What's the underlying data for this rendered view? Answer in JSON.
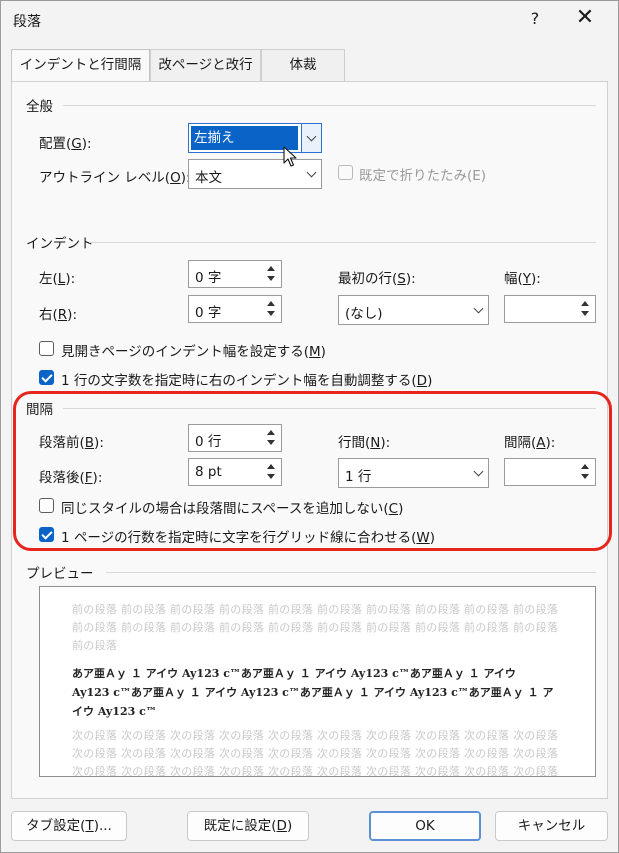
{
  "window": {
    "title": "段落",
    "help": "?",
    "close": "✕"
  },
  "tabs": [
    {
      "label": "インデントと行間隔",
      "active": true
    },
    {
      "label": "改ページと改行",
      "active": false
    },
    {
      "label": "体裁",
      "active": false
    }
  ],
  "general": {
    "title": "全般",
    "alignment_label": "配置(",
    "alignment_key": "G",
    "alignment_suffix": "):",
    "alignment_value": "左揃え",
    "outline_label": "アウトライン レベル(",
    "outline_key": "O",
    "outline_suffix": "):",
    "outline_value": "本文",
    "collapsed_label": "既定で折りたたみ(E)"
  },
  "indent": {
    "title": "インデント",
    "left_label": "左(",
    "left_key": "L",
    "left_suffix": "):",
    "left_value": "0 字",
    "right_label": "右(",
    "right_key": "R",
    "right_suffix": "):",
    "right_value": "0 字",
    "first_line_label": "最初の行(",
    "first_line_key": "S",
    "first_line_suffix": "):",
    "first_line_value": "(なし)",
    "width_label": "幅(",
    "width_key": "Y",
    "width_suffix": "):",
    "width_value": "",
    "mirror_label": "見開きページのインデント幅を設定する(",
    "mirror_key": "M",
    "mirror_suffix": ")",
    "mirror_checked": false,
    "auto_adjust_label": "1 行の文字数を指定時に右のインデント幅を自動調整する(",
    "auto_adjust_key": "D",
    "auto_adjust_suffix": ")",
    "auto_adjust_checked": true
  },
  "spacing": {
    "title": "間隔",
    "before_label": "段落前(",
    "before_key": "B",
    "before_suffix": "):",
    "before_value": "0 行",
    "after_label": "段落後(",
    "after_key": "F",
    "after_suffix": "):",
    "after_value": "8 pt",
    "line_spacing_label": "行間(",
    "line_spacing_key": "N",
    "line_spacing_suffix": "):",
    "line_spacing_value": "1 行",
    "at_label": "間隔(",
    "at_key": "A",
    "at_suffix": "):",
    "at_value": "",
    "no_space_label": "同じスタイルの場合は段落間にスペースを追加しない(",
    "no_space_key": "C",
    "no_space_suffix": ")",
    "no_space_checked": false,
    "grid_label": "1 ページの行数を指定時に文字を行グリッド線に合わせる(",
    "grid_key": "W",
    "grid_suffix": ")",
    "grid_checked": true
  },
  "preview": {
    "title": "プレビュー",
    "prev_lines": [
      "前の段落 前の段落 前の段落 前の段落 前の段落 前の段落 前の段落 前の段落 前の段落 前の段落",
      "前の段落 前の段落 前の段落 前の段落 前の段落 前の段落 前の段落 前の段落 前の段落 前の段落",
      "前の段落"
    ],
    "sample_lines": [
      "あア亜Ａｙ １ アイウ Ay123 c™あア亜Ａｙ １ アイウ Ay123 c™あア亜Ａｙ １ アイウ",
      "Ay123 c™あア亜Ａｙ １ アイウ Ay123 c™あア亜Ａｙ １ アイウ Ay123 c™あア亜Ａｙ １ ア",
      "イウ Ay123 c™"
    ],
    "next_lines": [
      "次の段落 次の段落 次の段落 次の段落 次の段落 次の段落 次の段落 次の段落 次の段落 次の段落",
      "次の段落 次の段落 次の段落 次の段落 次の段落 次の段落 次の段落 次の段落 次の段落 次の段落",
      "次の段落 次の段落 次の段落 次の段落 次の段落 次の段落 次の段落 次の段落 次の段落 次の段落",
      "次の段落 次の段落 次の段落 次の段落 次の段落 次の段落 次の段落 次の段落"
    ]
  },
  "buttons": {
    "tabs_label": "タブ設定(",
    "tabs_key": "T",
    "tabs_suffix": ")...",
    "default_label": "既定に設定(",
    "default_key": "D",
    "default_suffix": ")",
    "ok_label": "OK",
    "cancel_label": "キャンセル"
  },
  "colors": {
    "accent": "#0a64c8",
    "highlight": "#e8251c"
  }
}
